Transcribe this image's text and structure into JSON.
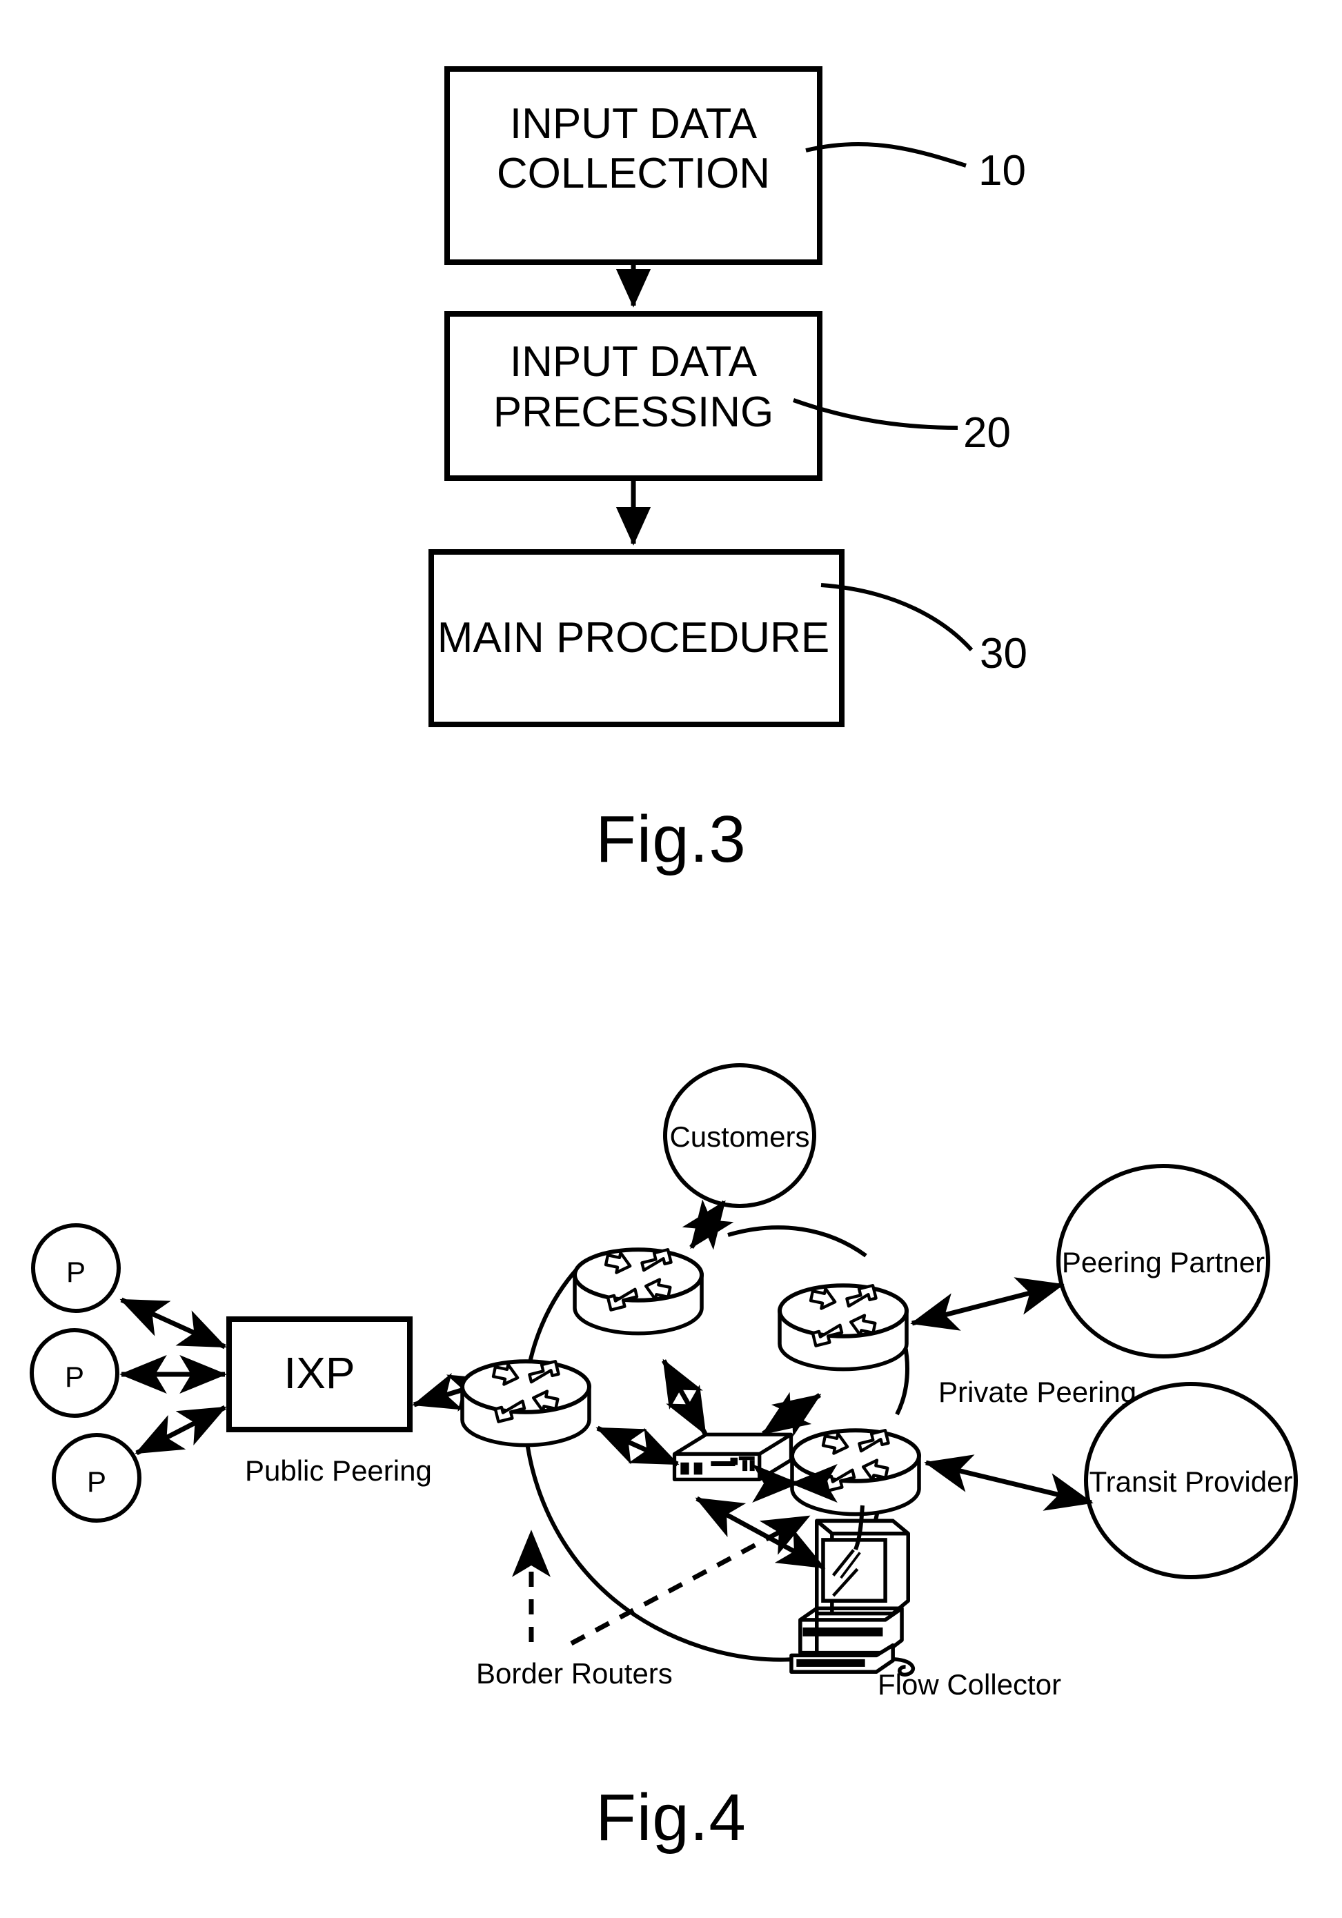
{
  "document": {
    "kind": "patent-drawing-sheet",
    "figures": [
      "Fig.3",
      "Fig.4"
    ]
  },
  "fig3": {
    "caption": "Fig.3",
    "boxes": [
      {
        "id": "input-data-collection",
        "line1": "INPUT DATA",
        "line2": "COLLECTION",
        "ref": "10"
      },
      {
        "id": "input-data-precessing",
        "line1": "INPUT DATA",
        "line2": "PRECESSING",
        "ref": "20"
      },
      {
        "id": "main-procedure",
        "line1": "MAIN PROCEDURE",
        "line2": "",
        "ref": "30"
      }
    ],
    "reference_numerals": [
      "10",
      "20",
      "30"
    ],
    "flow": [
      "INPUT DATA COLLECTION",
      "INPUT DATA PRECESSING",
      "MAIN PROCEDURE"
    ]
  },
  "fig4": {
    "caption": "Fig.4",
    "nodes": {
      "peer_1": "P",
      "peer_2": "P",
      "peer_3": "P",
      "ixp": "IXP",
      "customers": "Customers",
      "peering_partner": "Peering Partner",
      "transit_provider": "Transit Provider"
    },
    "labels": {
      "public_peering": "Public Peering",
      "private_peering": "Private Peering",
      "border_routers": "Border Routers",
      "flow_collector": "Flow Collector"
    },
    "icons": {
      "router": "router-icon",
      "switch": "switch-icon",
      "workstation": "workstation-icon"
    },
    "router_count": 4
  },
  "colors": {
    "ink": "#000000",
    "paper": "#ffffff"
  }
}
